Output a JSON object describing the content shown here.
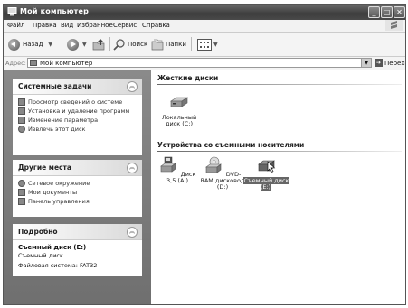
{
  "window": {
    "title": "Мой компьютер"
  },
  "menu": {
    "items": [
      "Файл",
      "Правка",
      "Вид",
      "Избранное",
      "Сервис",
      "Справка"
    ]
  },
  "toolbar": {
    "back_label": "Назад",
    "search_label": "Поиск",
    "folders_label": "Папки"
  },
  "address": {
    "label": "Адрес:",
    "value": "Мой компьютер",
    "go_label": "Переход"
  },
  "sidebar": {
    "system_tasks": {
      "title": "Системные задачи",
      "items": [
        "Просмотр сведений о системе",
        "Установка и удаление программ",
        "Изменение параметра",
        "Извлечь этот диск"
      ]
    },
    "other_places": {
      "title": "Другие места",
      "items": [
        "Сетевое окружение",
        "Мои документы",
        "Панель управления"
      ]
    },
    "details": {
      "title": "Подробно",
      "name": "Съемный диск (E:)",
      "type": "Съемный диск",
      "filesystem": "Файловая система: FAT32"
    }
  },
  "main": {
    "hard_drives": {
      "title": "Жесткие диски",
      "items": [
        {
          "label": "Локальный диск (C:)",
          "icon": "hard-drive-icon"
        }
      ]
    },
    "removable": {
      "title": "Устройства со съемными носителями",
      "items": [
        {
          "label": "Диск 3,5 (A:)",
          "icon": "floppy-drive-icon"
        },
        {
          "label": "DVD-RAM дисковод (D:)",
          "icon": "dvd-drive-icon"
        },
        {
          "label": "Съемный диск (E:)",
          "icon": "removable-disk-icon",
          "selected": true
        }
      ]
    }
  }
}
